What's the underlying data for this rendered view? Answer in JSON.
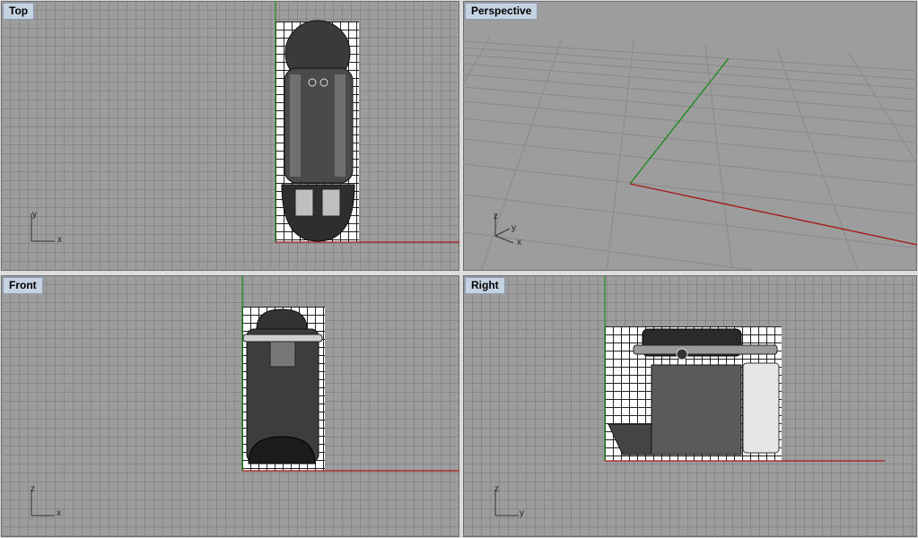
{
  "viewports": {
    "top": {
      "title": "Top",
      "axis_h": "x",
      "axis_v": "y"
    },
    "perspective": {
      "title": "Perspective",
      "axis_h": "x",
      "axis_v": "y",
      "axis_z": "z"
    },
    "front": {
      "title": "Front",
      "axis_h": "x",
      "axis_v": "z"
    },
    "right": {
      "title": "Right",
      "axis_h": "y",
      "axis_v": "z"
    }
  },
  "colors": {
    "x_axis": "#a51c1c",
    "y_axis": "#1c8a1c",
    "grid_bg": "#9d9d9d",
    "title_bg": "#c5d2e2"
  },
  "background_object": "coffee-machine-reference"
}
